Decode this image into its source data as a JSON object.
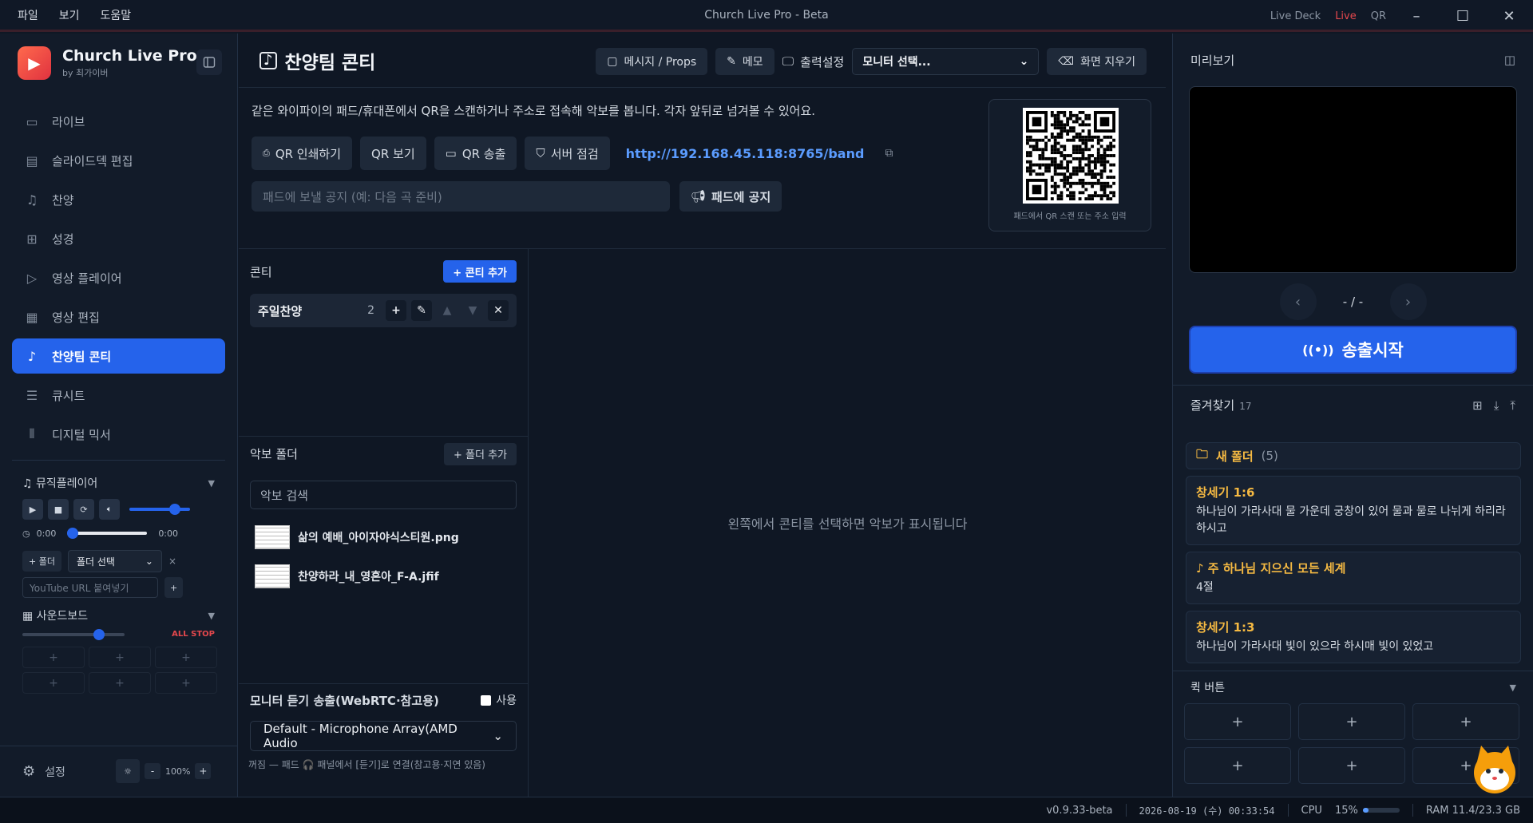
{
  "menu": [
    "파일",
    "보기",
    "도움말"
  ],
  "window_title": "Church Live Pro - Beta",
  "topright": {
    "deck": "Live Deck",
    "live": "Live",
    "qr": "QR",
    "min": "–",
    "max": "☐",
    "close": "✕"
  },
  "brand": {
    "name": "Church Live Pro",
    "by": "by 최가이버"
  },
  "nav": [
    {
      "label": "라이브",
      "icon": "camera-icon"
    },
    {
      "label": "슬라이드덱 편집",
      "icon": "slides-icon"
    },
    {
      "label": "찬양",
      "icon": "music-icon"
    },
    {
      "label": "성경",
      "icon": "bible-icon"
    },
    {
      "label": "영상 플레이어",
      "icon": "play-icon"
    },
    {
      "label": "영상 편집",
      "icon": "video-edit-icon"
    },
    {
      "label": "찬양팀 콘티",
      "icon": "worship-icon",
      "active": true
    },
    {
      "label": "큐시트",
      "icon": "cue-icon"
    },
    {
      "label": "디지털 믹서",
      "icon": "mixer-icon"
    }
  ],
  "music_player": {
    "title": "뮤직플레이어",
    "time_start": "0:00",
    "time_end": "0:00",
    "volume": 0.8,
    "position": 0.0,
    "add_folder": "+ 폴더",
    "folder_select": "폴더 선택",
    "url_placeholder": "YouTube URL 붙여넣기",
    "add": "+",
    "clear": "×"
  },
  "soundboard": {
    "title": "사운드보드",
    "all_stop": "ALL STOP",
    "level": 0.78,
    "cells": [
      "+",
      "+",
      "+",
      "+",
      "+",
      "+"
    ]
  },
  "settings": {
    "label": "설정",
    "zoom": "100%",
    "minus": "-",
    "plus": "+"
  },
  "main": {
    "title": "찬양팀 콘티",
    "btn_props": "메시지 / Props",
    "btn_memo": "메모",
    "output_label": "출력설정",
    "monitor_select": "모니터 선택...",
    "btn_clear": "화면 지우기",
    "info_text": "같은 와이파이의 패드/휴대폰에서 QR을 스캔하거나 주소로 접속해 악보를 봅니다. 각자 앞뒤로 넘겨볼 수 있어요.",
    "qr_buttons": [
      "QR 인쇄하기",
      "QR 보기",
      "QR 송출",
      "서버 점검"
    ],
    "url": "http://192.168.45.118:8765/band",
    "notice_placeholder": "패드에 보낼 공지 (예: 다음 곡 준비)",
    "notice_button": "패드에 공지",
    "qr_caption": "패드에서 QR 스캔 또는 주소 입력"
  },
  "conti": {
    "title": "콘티",
    "add": "+ 콘티 추가",
    "sets": [
      {
        "name": "주일찬양",
        "count": "2"
      }
    ]
  },
  "folder": {
    "title": "악보 폴더",
    "add": "+ 폴더 추가",
    "search_placeholder": "악보 검색",
    "files": [
      "삶의 예배_아이자야식스티원.png",
      "찬양하라_내_영혼아_F-A.jfif"
    ]
  },
  "monitor": {
    "title": "모니터 듣기 송출(WebRTC·참고용)",
    "use": "사용",
    "device": "Default - Microphone Array(AMD Audio",
    "note": "꺼짐 — 패드 🎧 패널에서 [듣기]로 연결(참고용·지연 있음)"
  },
  "empty_text": "왼쪽에서 콘티를 선택하면 악보가 표시됩니다",
  "preview": {
    "title": "미리보기",
    "page": "- / -",
    "go_live": "송출시작"
  },
  "favorites": {
    "title": "즐겨찾기",
    "count": "17",
    "folder": {
      "name": "새 폴더",
      "count": "(5)"
    },
    "items": [
      {
        "title": "창세기 1:6",
        "body": "하나님이 가라사대 물 가운데 궁창이 있어 물과 물로 나뉘게 하리라 하시고"
      },
      {
        "title": "♪ 주 하나님 지으신 모든 세계",
        "body": "4절"
      },
      {
        "title": "창세기 1:3",
        "body": "하나님이 가라사대 빛이 있으라 하시매 빛이 있었고"
      }
    ]
  },
  "quick": {
    "title": "퀵 버튼",
    "cells": [
      "+",
      "+",
      "+",
      "+",
      "+",
      "+"
    ]
  },
  "status": {
    "version": "v0.9.33-beta",
    "datetime": "2026-08-19 (수) 00:33:54",
    "cpu_label": "CPU",
    "cpu": "15%",
    "cpu_value": 0.15,
    "ram": "RAM 11.4/23.3 GB"
  },
  "colors": {
    "accent": "#2563eb",
    "fav_title": "#f5b942",
    "live": "#e5484d",
    "link": "#5b9cff"
  }
}
